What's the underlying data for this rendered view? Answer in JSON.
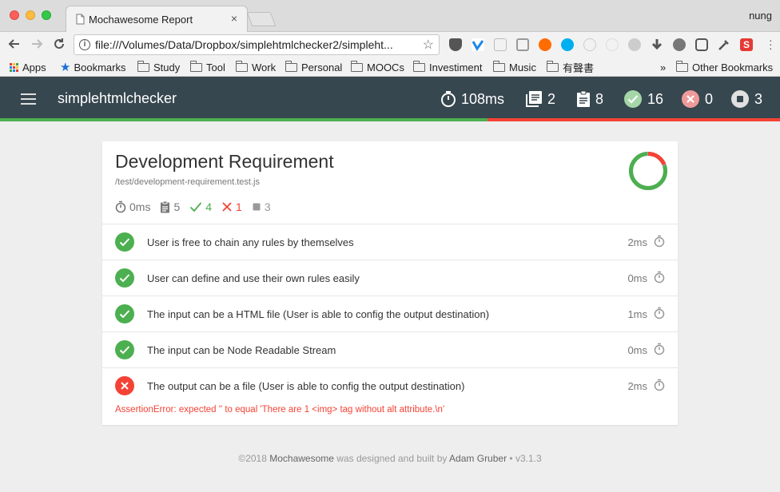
{
  "browser": {
    "tab_title": "Mochawesome Report",
    "tab_close": "×",
    "profile_name": "nung",
    "url": "file:///Volumes/Data/Dropbox/simplehtmlchecker2/simpleht...",
    "bookmarks": [
      {
        "label": "Apps",
        "icon": "apps-grid-icon"
      },
      {
        "label": "Bookmarks",
        "icon": "star-icon"
      },
      {
        "label": "Study",
        "icon": "folder-icon"
      },
      {
        "label": "Tool",
        "icon": "folder-icon"
      },
      {
        "label": "Work",
        "icon": "folder-icon"
      },
      {
        "label": "Personal",
        "icon": "folder-icon"
      },
      {
        "label": "MOOCs",
        "icon": "folder-icon"
      },
      {
        "label": "Investiment",
        "icon": "folder-icon"
      },
      {
        "label": "Music",
        "icon": "folder-icon"
      },
      {
        "label": "有聲書",
        "icon": "folder-icon"
      }
    ],
    "overflow": "»",
    "other_bookmarks": "Other Bookmarks"
  },
  "app": {
    "title": "simplehtmlchecker",
    "stats": {
      "duration": "108ms",
      "suites": "2",
      "tests": "8",
      "passes": "16",
      "failures": "0",
      "pending": "3"
    },
    "progress": {
      "pass_fraction": 0.625,
      "fail_fraction": 0.375
    }
  },
  "suite": {
    "title": "Development Requirement",
    "file": "/test/development-requirement.test.js",
    "duration": "0ms",
    "tests": "5",
    "passes": "4",
    "failures": "1",
    "pending": "3",
    "donut": {
      "pass_fraction": 0.8,
      "fail_fraction": 0.2
    }
  },
  "tests": [
    {
      "title": "User is free to chain any rules by themselves",
      "duration": "2ms",
      "state": "passed"
    },
    {
      "title": "User can define and use their own rules easily",
      "duration": "0ms",
      "state": "passed"
    },
    {
      "title": "The input can be a HTML file (User is able to config the output destination)",
      "duration": "1ms",
      "state": "passed"
    },
    {
      "title": "The input can be Node Readable Stream",
      "duration": "0ms",
      "state": "passed"
    },
    {
      "title": "The output can be a file (User is able to config the output destination)",
      "duration": "2ms",
      "state": "failed"
    }
  ],
  "error_message": "AssertionError: expected '' to equal 'There are 1 <img> tag without alt attribute.\\n'",
  "footer": {
    "copyright": "©2018 ",
    "project": "Mochawesome",
    "built_by": " was designed and built by ",
    "author": "Adam Gruber",
    "version": " • v3.1.3"
  },
  "colors": {
    "pass": "#4caf50",
    "fail": "#f44336",
    "pending": "#999999",
    "navbar": "#37474f"
  }
}
